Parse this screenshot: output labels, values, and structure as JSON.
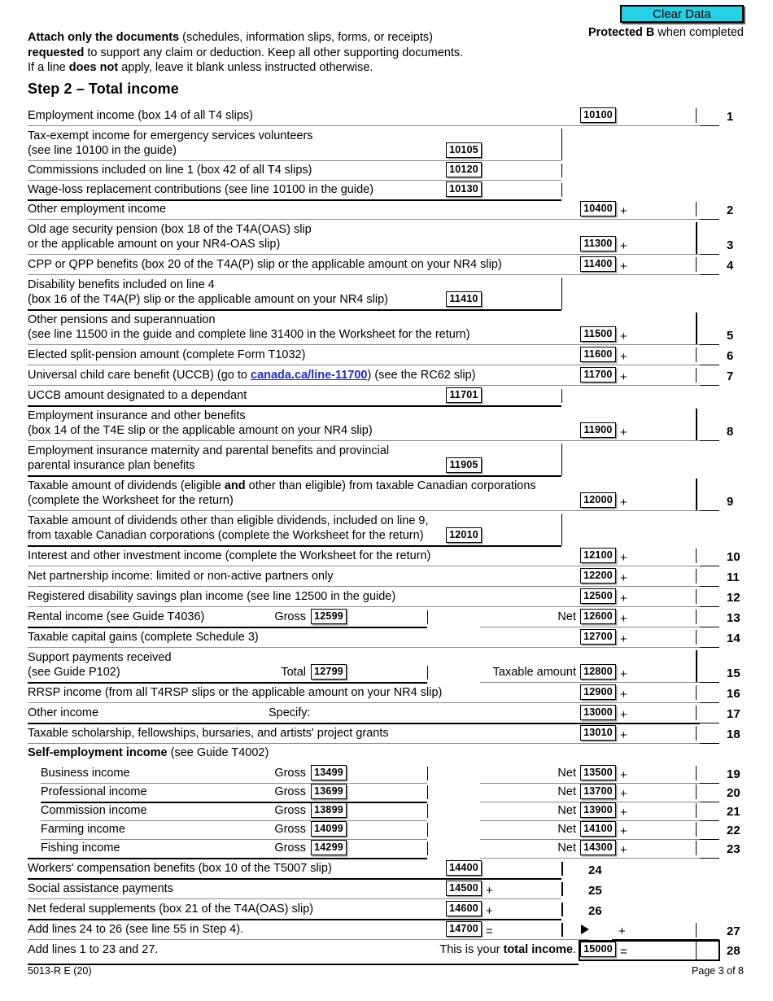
{
  "header": {
    "clear_data_label": "Clear Data",
    "protected_prefix": "Protected B",
    "protected_suffix": " when completed",
    "attach_note_line1_bold": "Attach only the documents",
    "attach_note_line1_rest": " (schedules, information slips, forms, or receipts)",
    "attach_note_line2_bold": "requested",
    "attach_note_line2_rest": " to support any claim or deduction. Keep all other supporting documents.",
    "attach_note_line3_a": "If a line ",
    "attach_note_line3_bold": "does not",
    "attach_note_line3_b": " apply, leave it blank unless instructed otherwise.",
    "step_heading": "Step 2 – Total income"
  },
  "rows": {
    "r1": {
      "label": "Employment income (box 14 of all T4 slips)",
      "code": "10100",
      "num": "1"
    },
    "r1a": {
      "label_l1": "Tax-exempt income for emergency services volunteers",
      "label_l2": "(see line 10100 in the guide)",
      "code": "10105"
    },
    "r1b": {
      "label": "Commissions included on line 1 (box 42 of all T4 slips)",
      "code": "10120"
    },
    "r1c": {
      "label": "Wage-loss replacement contributions (see line 10100 in the guide)",
      "code": "10130"
    },
    "r2": {
      "label": "Other employment income",
      "code": "10400",
      "op": "+",
      "num": "2"
    },
    "r3": {
      "label_l1": "Old age security pension (box 18 of the T4A(OAS) slip",
      "label_l2": "or the applicable amount on your NR4-OAS slip)",
      "code": "11300",
      "op": "+",
      "num": "3"
    },
    "r4": {
      "label": "CPP or QPP benefits (box 20 of the T4A(P) slip or the applicable amount on your NR4 slip)",
      "code": "11400",
      "op": "+",
      "num": "4"
    },
    "r4a": {
      "label_l1": "Disability benefits included on line 4",
      "label_l2": "(box 16 of the T4A(P) slip or the applicable amount on your NR4 slip)",
      "code": "11410"
    },
    "r5": {
      "label_l1": "Other pensions and superannuation",
      "label_l2": "(see line 11500 in the guide and complete line 31400 in the Worksheet for the return)",
      "code": "11500",
      "op": "+",
      "num": "5"
    },
    "r6": {
      "label": "Elected split-pension amount (complete Form T1032)",
      "code": "11600",
      "op": "+",
      "num": "6"
    },
    "r7": {
      "label_a": "Universal child care benefit (UCCB) (go to ",
      "link": "canada.ca/line-11700",
      "label_b": ") (see the RC62 slip)",
      "code": "11700",
      "op": "+",
      "num": "7"
    },
    "r7a": {
      "label": "UCCB amount designated to a dependant",
      "code": "11701"
    },
    "r8": {
      "label_l1": "Employment insurance and other benefits",
      "label_l2": "(box 14 of the T4E slip or the applicable amount on your NR4 slip)",
      "code": "11900",
      "op": "+",
      "num": "8"
    },
    "r8a": {
      "label_l1": "Employment insurance maternity and parental benefits and provincial",
      "label_l2": "parental insurance plan benefits",
      "code": "11905"
    },
    "r9": {
      "label_l1_a": "Taxable amount of dividends (eligible ",
      "label_l1_bold": "and",
      "label_l1_b": " other than eligible) from taxable Canadian corporations",
      "label_l2": "(complete the Worksheet for the return)",
      "code": "12000",
      "op": "+",
      "num": "9"
    },
    "r9a": {
      "label_l1": "Taxable amount of dividends other than eligible dividends, included on line 9,",
      "label_l2": "from taxable Canadian corporations (complete the Worksheet for the return)",
      "code": "12010"
    },
    "r10": {
      "label": "Interest and other investment income (complete the Worksheet for the return)",
      "code": "12100",
      "op": "+",
      "num": "10"
    },
    "r11": {
      "label": "Net partnership income: limited or non-active partners only",
      "code": "12200",
      "op": "+",
      "num": "11"
    },
    "r12": {
      "label": "Registered disability savings plan income (see line 12500 in the guide)",
      "code": "12500",
      "op": "+",
      "num": "12"
    },
    "r13": {
      "label": "Rental income (see Guide T4036)",
      "left_label": "Gross",
      "left_code": "12599",
      "right_label": "Net",
      "code": "12600",
      "op": "+",
      "num": "13"
    },
    "r14": {
      "label": "Taxable capital gains (complete Schedule 3)",
      "code": "12700",
      "op": "+",
      "num": "14"
    },
    "r15": {
      "label_l1": "Support payments received",
      "label_l2": "(see Guide P102)",
      "left_label": "Total",
      "left_code": "12799",
      "right_label": "Taxable amount",
      "code": "12800",
      "op": "+",
      "num": "15"
    },
    "r16": {
      "label": "RRSP income (from all T4RSP slips or the applicable amount on your NR4 slip)",
      "code": "12900",
      "op": "+",
      "num": "16"
    },
    "r17": {
      "label": "Other income",
      "specify_label": "Specify:",
      "code": "13000",
      "op": "+",
      "num": "17"
    },
    "r18": {
      "label": "Taxable scholarship, fellowships, bursaries, and artists' project grants",
      "code": "13010",
      "op": "+",
      "num": "18"
    },
    "self_heading_bold": "Self-employment income",
    "self_heading_rest": " (see Guide T4002)",
    "r19": {
      "label": "Business income",
      "left_label": "Gross",
      "left_code": "13499",
      "right_label": "Net",
      "code": "13500",
      "op": "+",
      "num": "19"
    },
    "r20": {
      "label": "Professional income",
      "left_label": "Gross",
      "left_code": "13699",
      "right_label": "Net",
      "code": "13700",
      "op": "+",
      "num": "20"
    },
    "r21": {
      "label": "Commission income",
      "left_label": "Gross",
      "left_code": "13899",
      "right_label": "Net",
      "code": "13900",
      "op": "+",
      "num": "21"
    },
    "r22": {
      "label": "Farming income",
      "left_label": "Gross",
      "left_code": "14099",
      "right_label": "Net",
      "code": "14100",
      "op": "+",
      "num": "22"
    },
    "r23": {
      "label": "Fishing income",
      "left_label": "Gross",
      "left_code": "14299",
      "right_label": "Net",
      "code": "14300",
      "op": "+",
      "num": "23"
    },
    "r24": {
      "label": "Workers' compensation benefits (box 10 of the T5007 slip)",
      "code": "14400",
      "num": "24"
    },
    "r25": {
      "label": "Social assistance payments",
      "code": "14500",
      "op": "+",
      "num": "25"
    },
    "r26": {
      "label": "Net federal supplements (box 21 of the T4A(OAS) slip)",
      "code": "14600",
      "op": "+",
      "num": "26"
    },
    "r27": {
      "label": "Add lines 24 to 26 (see line 55 in Step 4).",
      "code": "14700",
      "op": "=",
      "op2": "+",
      "num": "27"
    },
    "r28": {
      "label": "Add lines 1 to 23 and 27.",
      "total_a": "This is your ",
      "total_bold": "total income",
      "total_b": ".",
      "code": "15000",
      "op": "=",
      "num": "28"
    }
  },
  "footer": {
    "form_id": "5013-R E (20)",
    "page": "Page 3 of 8"
  },
  "colors": {
    "clear_data_bg": "#25D0E5",
    "link": "#1a2ae0",
    "rule": "#8a8a8a",
    "text": "#000000"
  }
}
